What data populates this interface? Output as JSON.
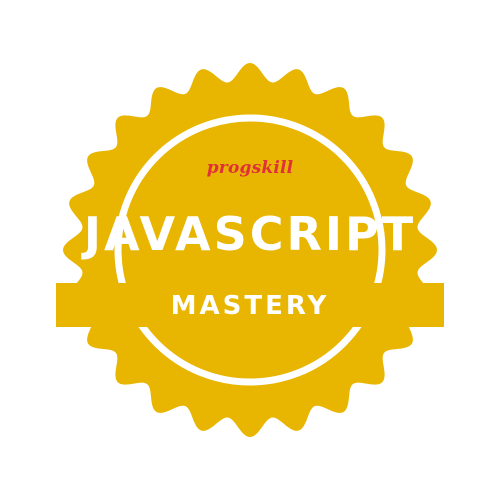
{
  "badge": {
    "brand": "progskill",
    "title": "JAVASCRIPT",
    "ribbon": "MASTERY"
  },
  "colors": {
    "background": "#ffffff",
    "gold": "#e8b500",
    "white": "#ffffff",
    "brand_red": "#e0303a"
  }
}
